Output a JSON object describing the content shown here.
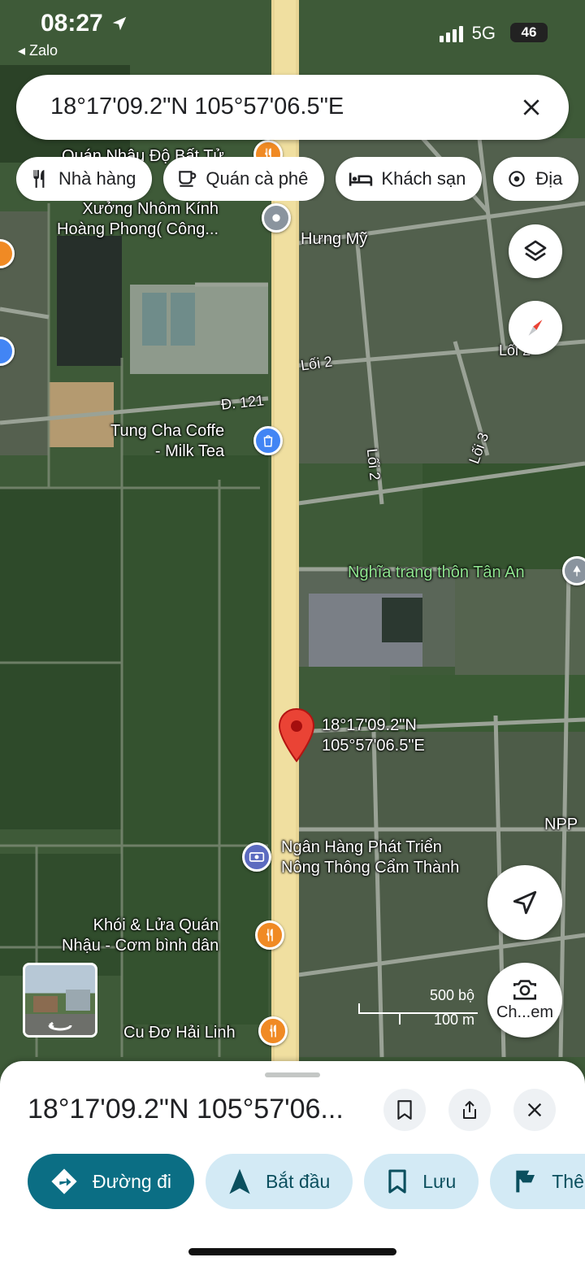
{
  "status_bar": {
    "time": "08:27",
    "back_app": "◂ Zalo",
    "network": "5G",
    "battery": "46"
  },
  "search": {
    "query": "18°17'09.2\"N 105°57'06.5\"E"
  },
  "chips": [
    {
      "icon": "restaurant-icon",
      "label": "Nhà hàng"
    },
    {
      "icon": "coffee-icon",
      "label": "Quán cà phê"
    },
    {
      "icon": "hotel-icon",
      "label": "Khách sạn"
    },
    {
      "icon": "attraction-icon",
      "label": "Địa"
    }
  ],
  "map_labels": {
    "poi_top": "Quán Nhậu Độ Bất Tử",
    "workshop": "Xưởng Nhôm Kính\nHoàng Phong( Công...",
    "hung_my": "Hưng Mỹ",
    "loi2_a": "Lối 2",
    "loi2_b": "Lối 2",
    "loi3": "Lối 3",
    "loi_right": "Lối 2",
    "road": "Đ. 121",
    "cafe": "Tung Cha Coffe\n- Milk Tea",
    "cemetery": "Nghĩa trang thôn Tân An",
    "pin_coords": "18°17'09.2\"N\n105°57'06.5\"E",
    "npp": "NPP",
    "bank": "Ngân Hàng Phát Triển\nNông Thông Cẩm Thành",
    "restaurant": "Khói & Lửa Quán\nNhậu - Cơm bình dân",
    "cudo": "Cu Đơ Hải Linh"
  },
  "scale": {
    "imperial": "500 bộ",
    "metric": "100 m"
  },
  "camera_button": {
    "label": "Ch...em"
  },
  "sheet": {
    "title": "18°17'09.2\"N 105°57'06...",
    "actions": [
      {
        "label": "Đường đi",
        "icon": "directions-icon"
      },
      {
        "label": "Bắt đầu",
        "icon": "navigation-icon"
      },
      {
        "label": "Lưu",
        "icon": "bookmark-icon"
      },
      {
        "label": "Thêm",
        "icon": "flag-icon"
      }
    ]
  },
  "colors": {
    "primary": "#0b6e84",
    "tonal": "#d3eaf5",
    "pin": "#ea4335",
    "poi_orange": "#f08a24"
  }
}
